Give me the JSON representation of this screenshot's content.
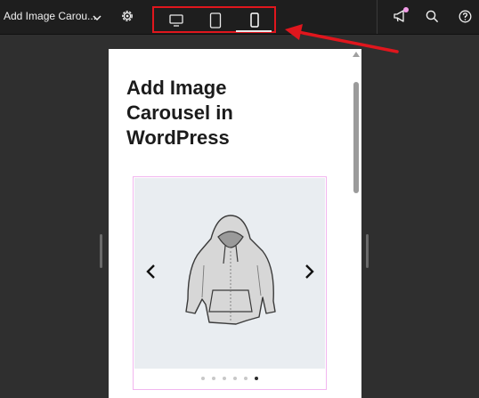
{
  "toolbar": {
    "document_title": "Add Image Carou...",
    "devices": [
      "desktop",
      "tablet",
      "mobile"
    ],
    "active_device": "mobile"
  },
  "icons": {
    "dropdown": "chevron-down-icon",
    "settings": "gear-icon",
    "desktop": "desktop-icon",
    "tablet": "tablet-icon",
    "mobile": "mobile-icon",
    "announcements": "megaphone-icon",
    "search": "search-icon",
    "help": "help-icon"
  },
  "colors": {
    "highlight_box": "#e0161d",
    "annotation_arrow": "#e0161d",
    "notification_dot": "#f39ce8",
    "carousel_border": "#f2b6ef"
  },
  "preview": {
    "heading": "Add Image Carousel in WordPress",
    "carousel": {
      "image": "hoodie sketch",
      "slide_count": 6,
      "active_slide": 6
    }
  }
}
